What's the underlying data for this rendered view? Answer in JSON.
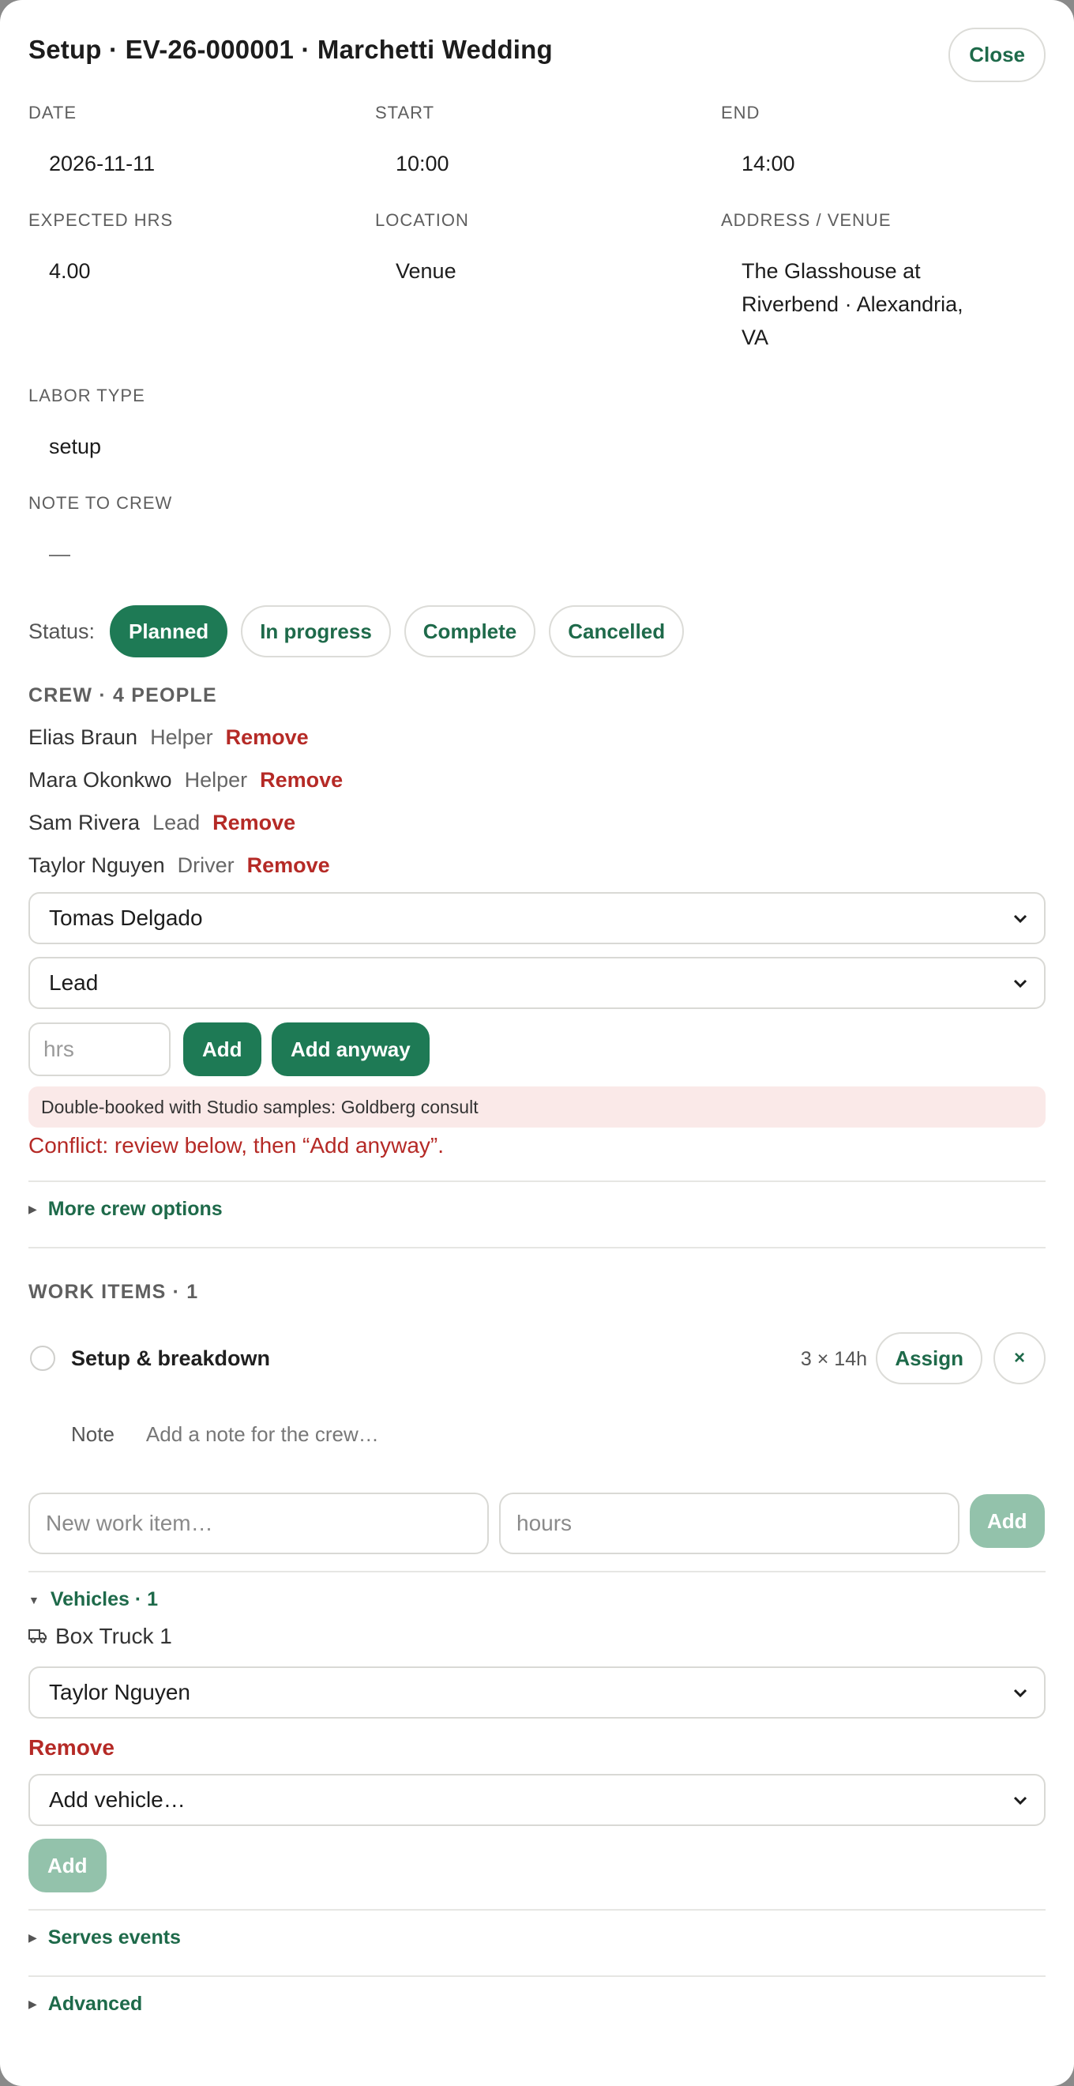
{
  "header": {
    "title": "Setup · EV-26-000001 · Marchetti Wedding",
    "close_label": "Close"
  },
  "fields": {
    "date": {
      "label": "DATE",
      "value": "2026-11-11"
    },
    "start": {
      "label": "START",
      "value": "10:00"
    },
    "end": {
      "label": "END",
      "value": "14:00"
    },
    "expected_hrs": {
      "label": "EXPECTED HRS",
      "value": "4.00"
    },
    "location": {
      "label": "LOCATION",
      "value": "Venue"
    },
    "address": {
      "label": "ADDRESS / VENUE",
      "line1": "The Glasshouse at",
      "line2": "Riverbend · Alexandria,",
      "line3": "VA"
    },
    "labor_type": {
      "label": "LABOR TYPE",
      "value": "setup"
    },
    "note": {
      "label": "NOTE TO CREW",
      "value": "—"
    }
  },
  "status": {
    "label": "Status:",
    "options": [
      "Planned",
      "In progress",
      "Complete",
      "Cancelled"
    ],
    "selected": "Planned"
  },
  "crew": {
    "heading": "CREW · 4 PEOPLE",
    "remove_label": "Remove",
    "members": [
      {
        "name": "Elias Braun",
        "role": "Helper"
      },
      {
        "name": "Mara Okonkwo",
        "role": "Helper"
      },
      {
        "name": "Sam Rivera",
        "role": "Lead"
      },
      {
        "name": "Taylor Nguyen",
        "role": "Driver"
      }
    ],
    "person_select": "Tomas Delgado",
    "role_select": "Lead",
    "hrs_placeholder": "hrs",
    "add_label": "Add",
    "add_anyway_label": "Add anyway",
    "alert": "Double-booked with Studio samples: Goldberg consult",
    "conflict": "Conflict: review below, then “Add anyway”.",
    "more_options": "More crew options"
  },
  "work_items": {
    "heading": "WORK ITEMS · 1",
    "items": [
      {
        "name": "Setup & breakdown",
        "meta": "3 × 14h",
        "assign_label": "Assign",
        "remove_label": "×"
      }
    ],
    "note_label": "Note",
    "note_placeholder": "Add a note for the crew…",
    "new_item_placeholder": "New work item…",
    "hours_placeholder": "hours",
    "add_label": "Add"
  },
  "vehicles": {
    "heading": "Vehicles · 1",
    "vehicle_name": "Box Truck 1",
    "driver_select": "Taylor Nguyen",
    "remove_label": "Remove",
    "add_vehicle_select": "Add vehicle…",
    "add_label": "Add"
  },
  "serves_events": "Serves events",
  "advanced": "Advanced",
  "colors": {
    "accent": "#1e7a55",
    "accent_text": "#1e6a4a",
    "danger": "#b52a26",
    "alert_bg": "#fae9e8",
    "disabled": "#93c2ab"
  }
}
